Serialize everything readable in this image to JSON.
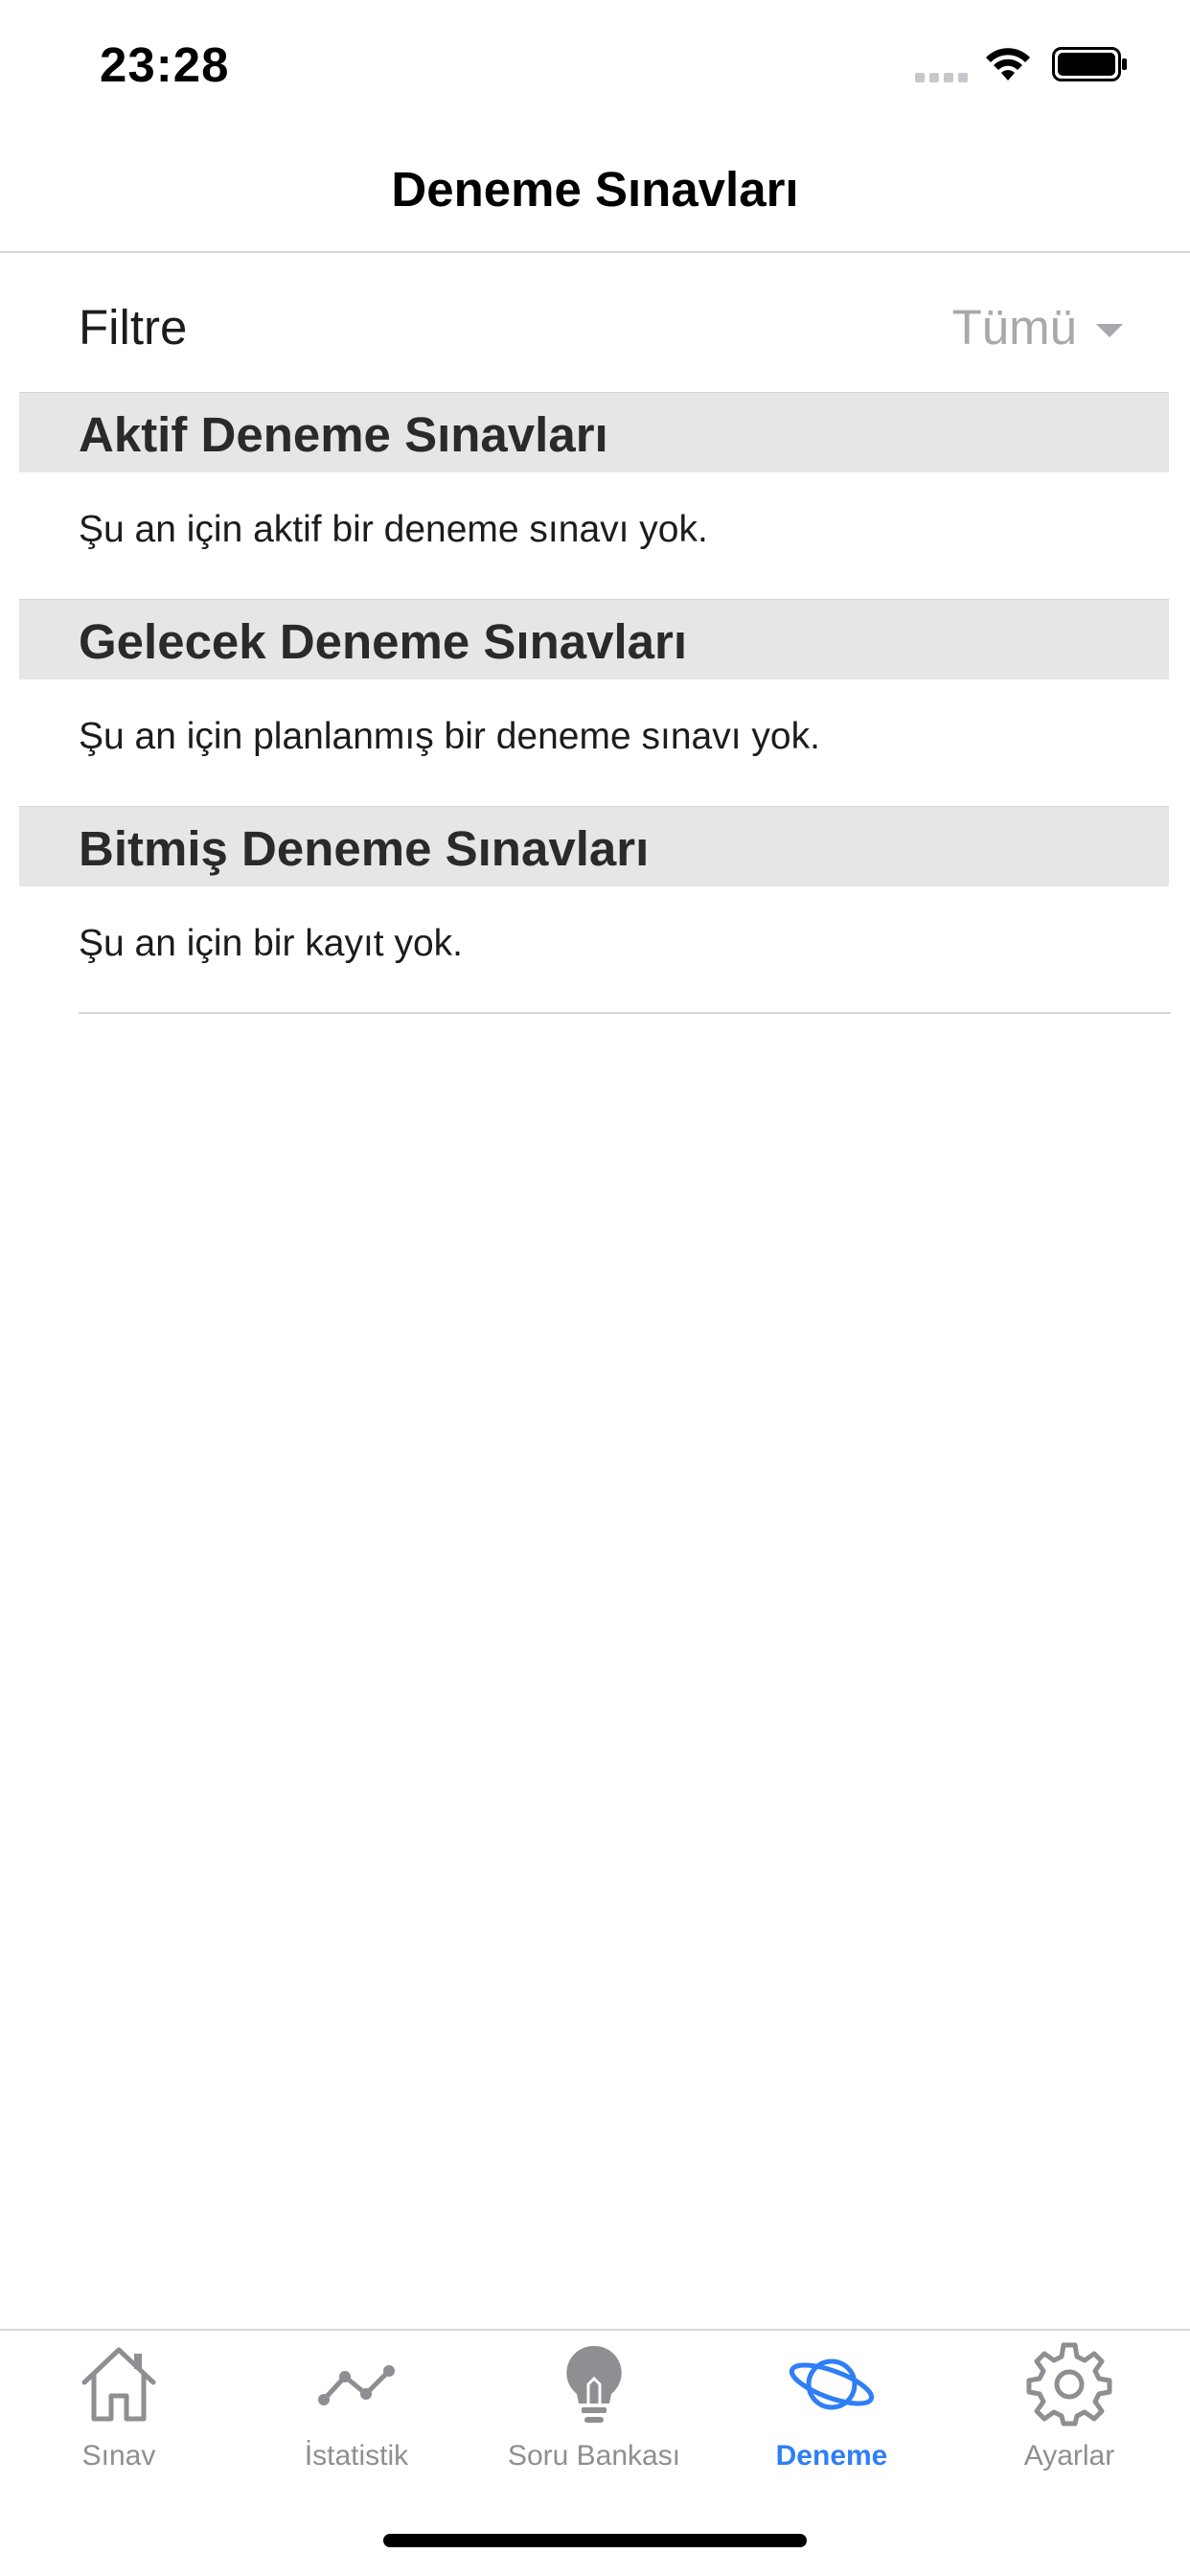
{
  "status_bar": {
    "time": "23:28"
  },
  "nav": {
    "title": "Deneme Sınavları"
  },
  "filter": {
    "label": "Filtre",
    "value": "Tümü"
  },
  "sections": [
    {
      "title": "Aktif Deneme Sınavları",
      "empty_text": "Şu an için aktif bir deneme sınavı yok."
    },
    {
      "title": "Gelecek Deneme Sınavları",
      "empty_text": "Şu an için planlanmış bir deneme sınavı yok."
    },
    {
      "title": "Bitmiş Deneme Sınavları",
      "empty_text": "Şu an için bir kayıt yok."
    }
  ],
  "tabs": [
    {
      "label": "Sınav",
      "icon": "house-icon",
      "active": false
    },
    {
      "label": "İstatistik",
      "icon": "chart-line-icon",
      "active": false
    },
    {
      "label": "Soru Bankası",
      "icon": "lightbulb-icon",
      "active": false
    },
    {
      "label": "Deneme",
      "icon": "planet-icon",
      "active": true
    },
    {
      "label": "Ayarlar",
      "icon": "gear-icon",
      "active": false
    }
  ],
  "colors": {
    "accent": "#2f7ef5",
    "inactive": "#8e8e93",
    "section_header_bg": "#e6e6e6",
    "placeholder": "#a8a8ad"
  }
}
